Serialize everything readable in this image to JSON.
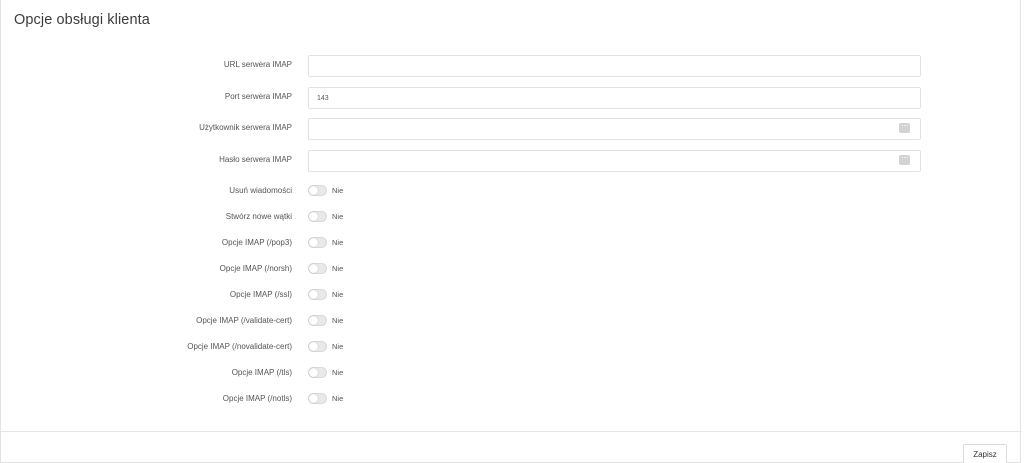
{
  "page": {
    "title": "Opcje obsługi klienta"
  },
  "fields": [
    {
      "label": "URL serwera IMAP",
      "value": ""
    },
    {
      "label": "Port serwera IMAP",
      "value": "143"
    },
    {
      "label": "Użytkownik serwera IMAP",
      "value": ""
    },
    {
      "label": "Hasło serwera IMAP",
      "value": ""
    }
  ],
  "toggles": [
    {
      "label": "Usuń wiadomości",
      "state": "Nie"
    },
    {
      "label": "Stwórz nowe wątki",
      "state": "Nie"
    },
    {
      "label": "Opcje IMAP (/pop3)",
      "state": "Nie"
    },
    {
      "label": "Opcje IMAP (/norsh)",
      "state": "Nie"
    },
    {
      "label": "Opcje IMAP (/ssl)",
      "state": "Nie"
    },
    {
      "label": "Opcje IMAP (/validate-cert)",
      "state": "Nie"
    },
    {
      "label": "Opcje IMAP (/novalidate-cert)",
      "state": "Nie"
    },
    {
      "label": "Opcje IMAP (/tls)",
      "state": "Nie"
    },
    {
      "label": "Opcje IMAP (/notls)",
      "state": "Nie"
    }
  ],
  "footer": {
    "save_label": "Zapisz"
  },
  "icons": {
    "password_helper": "more-dots-icon"
  }
}
